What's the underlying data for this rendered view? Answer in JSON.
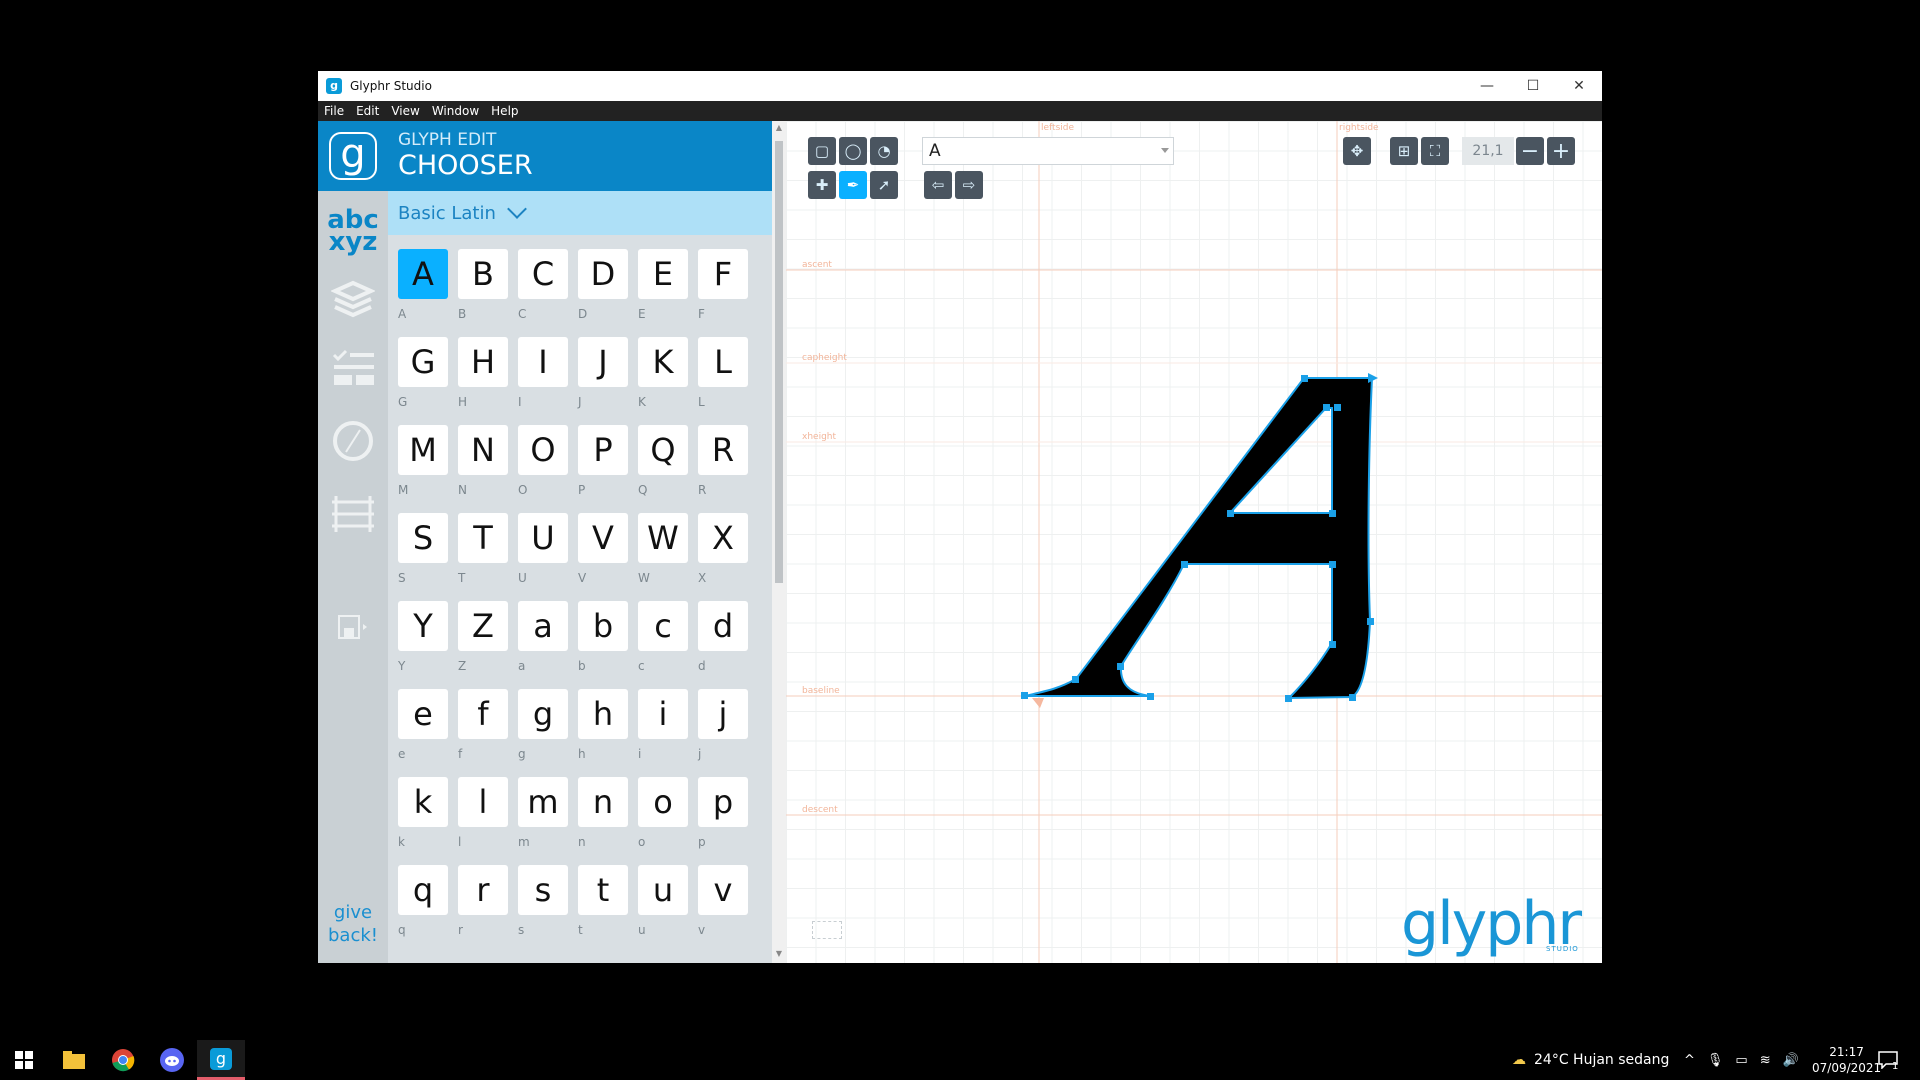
{
  "window": {
    "title": "Glyphr Studio",
    "minimize": "—",
    "maximize": "☐",
    "close": "✕"
  },
  "menu": [
    "File",
    "Edit",
    "View",
    "Window",
    "Help"
  ],
  "sidebar": {
    "give_back": [
      "give",
      "back!"
    ],
    "abc_line1": "abc",
    "abc_line2": "xyz"
  },
  "panel": {
    "subtitle": "GLYPH EDIT",
    "title": "CHOOSER",
    "range": "Basic Latin"
  },
  "glyphs": [
    {
      "char": "A",
      "label": "A",
      "selected": true
    },
    {
      "char": "B",
      "label": "B"
    },
    {
      "char": "C",
      "label": "C"
    },
    {
      "char": "D",
      "label": "D"
    },
    {
      "char": "E",
      "label": "E"
    },
    {
      "char": "F",
      "label": "F"
    },
    {
      "char": "G",
      "label": "G"
    },
    {
      "char": "H",
      "label": "H"
    },
    {
      "char": "I",
      "label": "I"
    },
    {
      "char": "J",
      "label": "J"
    },
    {
      "char": "K",
      "label": "K"
    },
    {
      "char": "L",
      "label": "L"
    },
    {
      "char": "M",
      "label": "M"
    },
    {
      "char": "N",
      "label": "N"
    },
    {
      "char": "O",
      "label": "O"
    },
    {
      "char": "P",
      "label": "P"
    },
    {
      "char": "Q",
      "label": "Q"
    },
    {
      "char": "R",
      "label": "R"
    },
    {
      "char": "S",
      "label": "S"
    },
    {
      "char": "T",
      "label": "T"
    },
    {
      "char": "U",
      "label": "U"
    },
    {
      "char": "V",
      "label": "V"
    },
    {
      "char": "W",
      "label": "W"
    },
    {
      "char": "X",
      "label": "X"
    },
    {
      "char": "Y",
      "label": "Y"
    },
    {
      "char": "Z",
      "label": "Z"
    },
    {
      "char": "a",
      "label": "a"
    },
    {
      "char": "b",
      "label": "b"
    },
    {
      "char": "c",
      "label": "c"
    },
    {
      "char": "d",
      "label": "d"
    },
    {
      "char": "e",
      "label": "e"
    },
    {
      "char": "f",
      "label": "f"
    },
    {
      "char": "g",
      "label": "g"
    },
    {
      "char": "h",
      "label": "h"
    },
    {
      "char": "i",
      "label": "i"
    },
    {
      "char": "j",
      "label": "j"
    },
    {
      "char": "k",
      "label": "k"
    },
    {
      "char": "l",
      "label": "l"
    },
    {
      "char": "m",
      "label": "m"
    },
    {
      "char": "n",
      "label": "n"
    },
    {
      "char": "o",
      "label": "o"
    },
    {
      "char": "p",
      "label": "p"
    },
    {
      "char": "q",
      "label": "q"
    },
    {
      "char": "r",
      "label": "r"
    },
    {
      "char": "s",
      "label": "s"
    },
    {
      "char": "t",
      "label": "t"
    },
    {
      "char": "u",
      "label": "u"
    },
    {
      "char": "v",
      "label": "v"
    }
  ],
  "editor": {
    "glyph_select": "A",
    "zoom": "21,1",
    "guides": {
      "leftside": "leftside",
      "rightside": "rightside",
      "ascent": "ascent",
      "capheight": "capheight",
      "xheight": "xheight",
      "baseline": "baseline",
      "descent": "descent"
    },
    "brand": "glyphr",
    "brand_sub": "STUDIO"
  },
  "taskbar": {
    "weather": "24°C  Hujan sedang",
    "time": "21:17",
    "date": "07/09/2021",
    "notifications": "1"
  },
  "colors": {
    "accent": "#0a86c7",
    "selected": "#0ab0ff",
    "path": "#1aa0e8"
  }
}
